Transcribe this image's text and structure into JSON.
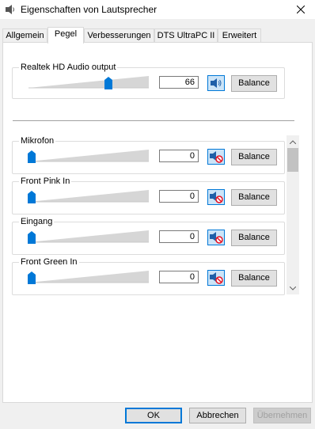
{
  "window": {
    "title": "Eigenschaften von Lautsprecher"
  },
  "tabs": [
    {
      "label": "Allgemein",
      "active": false
    },
    {
      "label": "Pegel",
      "active": true
    },
    {
      "label": "Verbesserungen",
      "active": false
    },
    {
      "label": "DTS UltraPC II",
      "active": false
    },
    {
      "label": "Erweitert",
      "active": false
    }
  ],
  "main_output": {
    "label": "Realtek HD Audio output",
    "value": "66",
    "level": 0.66,
    "muted": false,
    "balance_label": "Balance"
  },
  "inputs": [
    {
      "label": "Mikrofon",
      "value": "0",
      "level": 0,
      "muted": true,
      "balance_label": "Balance"
    },
    {
      "label": "Front Pink In",
      "value": "0",
      "level": 0,
      "muted": true,
      "balance_label": "Balance"
    },
    {
      "label": "Eingang",
      "value": "0",
      "level": 0,
      "muted": true,
      "balance_label": "Balance"
    },
    {
      "label": "Front Green In",
      "value": "0",
      "level": 0,
      "muted": true,
      "balance_label": "Balance"
    }
  ],
  "icons": {
    "speaker": "speaker-icon",
    "muted_speaker": "speaker-muted-icon",
    "close": "close-icon",
    "app": "speaker-app-icon"
  },
  "colors": {
    "accent": "#0078d7",
    "mute_red": "#e81123"
  },
  "footer": {
    "ok": "OK",
    "cancel": "Abbrechen",
    "apply": "Übernehmen",
    "apply_disabled": true
  }
}
